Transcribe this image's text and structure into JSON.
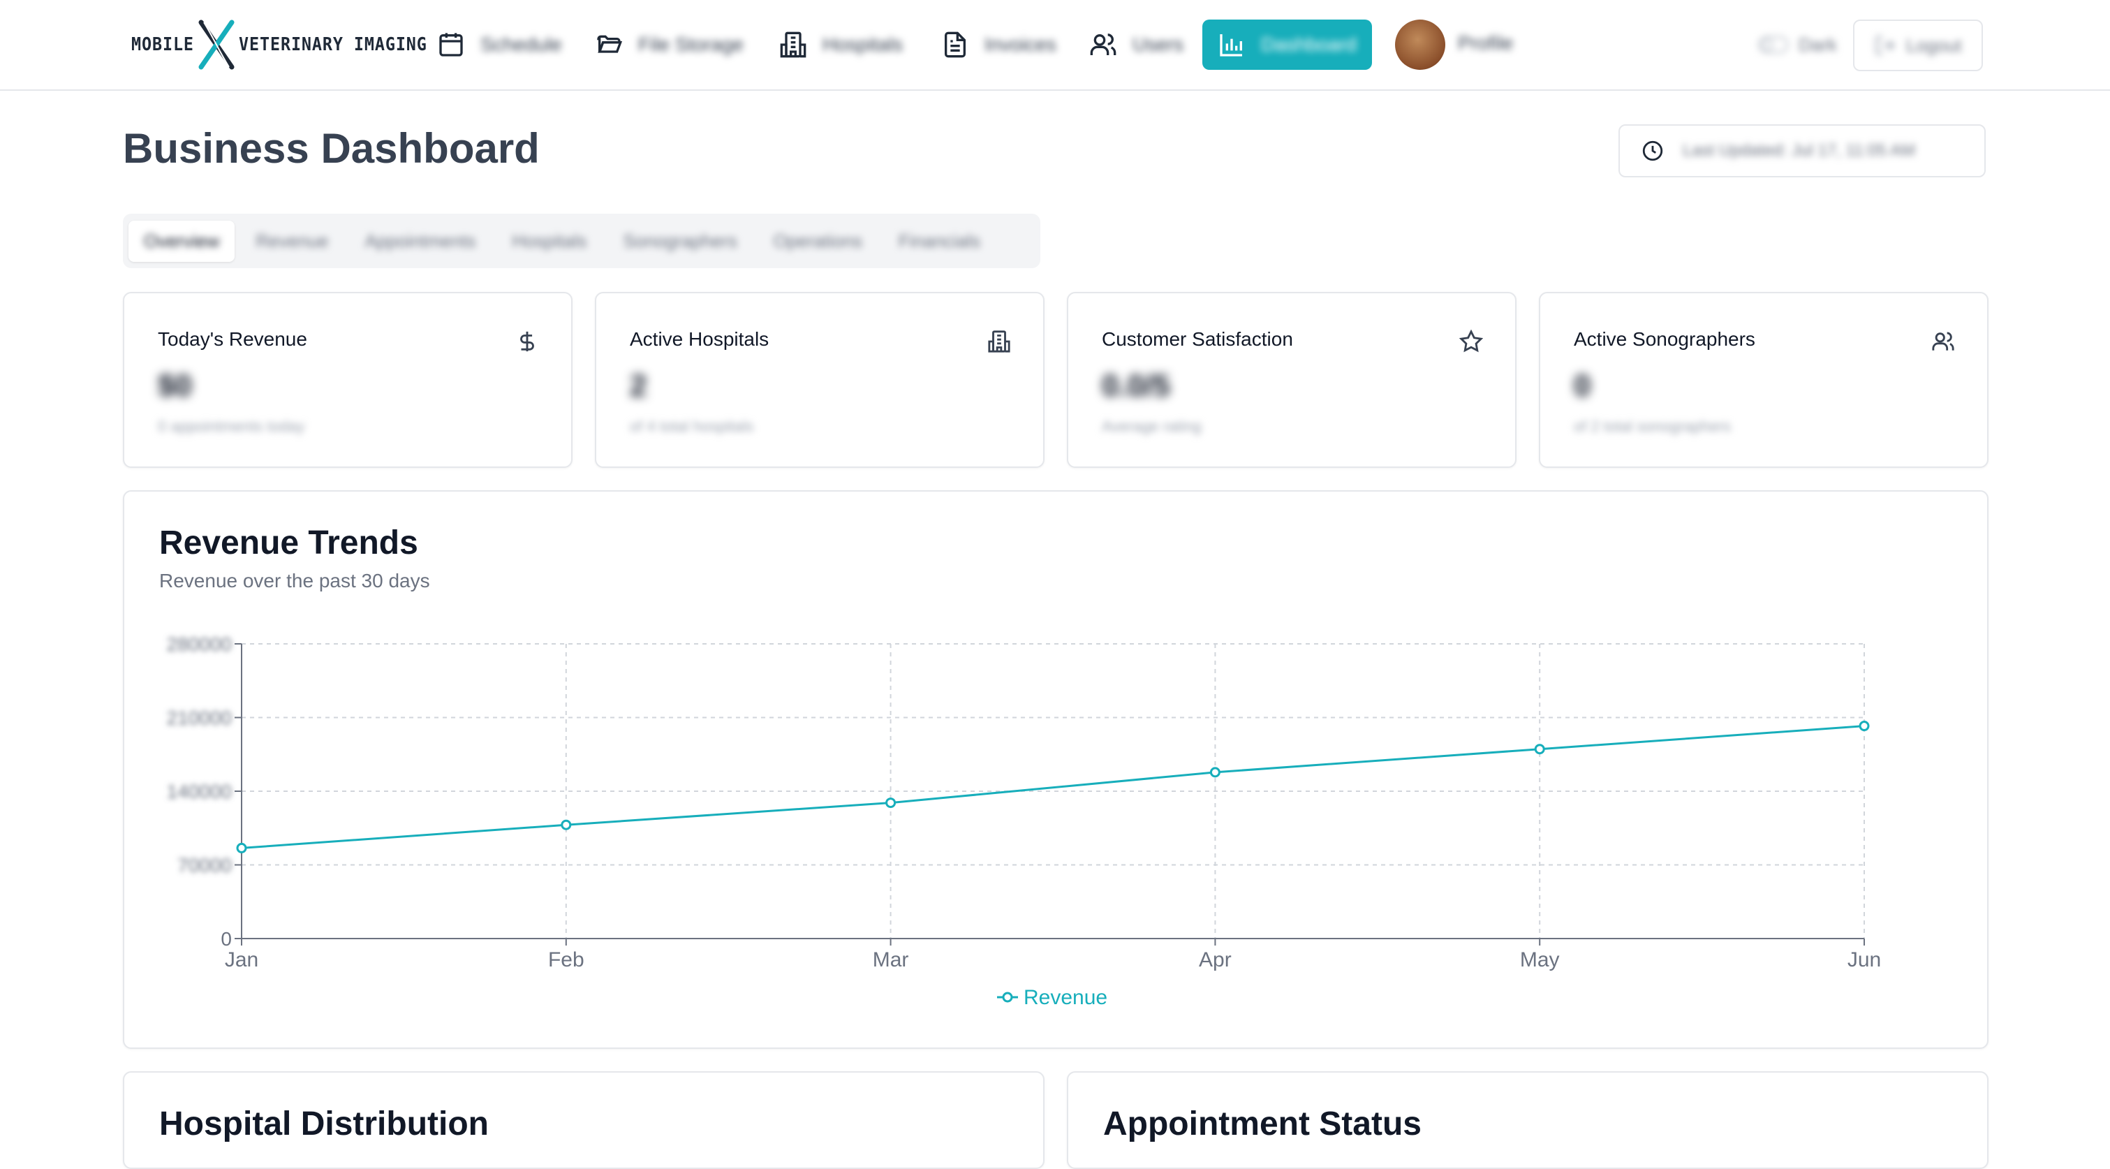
{
  "brand": {
    "left": "MOBILE",
    "right": "VETERINARY IMAGING"
  },
  "nav": {
    "items": [
      {
        "label": "Schedule",
        "icon": "calendar-icon"
      },
      {
        "label": "File Storage",
        "icon": "folder-icon"
      },
      {
        "label": "Hospitals",
        "icon": "building-icon"
      },
      {
        "label": "Invoices",
        "icon": "document-icon"
      },
      {
        "label": "Users",
        "icon": "users-icon"
      },
      {
        "label": "Dashboard",
        "icon": "bar-chart-icon",
        "active": true
      }
    ],
    "profile_label": "Profile",
    "theme_label": "Dark",
    "logout_label": "Logout",
    "accent": "#17aebb"
  },
  "page": {
    "title": "Business Dashboard",
    "last_updated": "Last Updated: Jul 17, 11:05 AM"
  },
  "tabs": [
    "Overview",
    "Revenue",
    "Appointments",
    "Hospitals",
    "Sonographers",
    "Operations",
    "Financials"
  ],
  "stats": [
    {
      "title": "Today's Revenue",
      "value": "$0",
      "sub": "0 appointments today",
      "icon": "dollar-icon"
    },
    {
      "title": "Active Hospitals",
      "value": "2",
      "sub": "of 4 total hospitals",
      "icon": "building-icon"
    },
    {
      "title": "Customer Satisfaction",
      "value": "0.0/5",
      "sub": "Average rating",
      "icon": "star-icon"
    },
    {
      "title": "Active Sonographers",
      "value": "0",
      "sub": "of 2 total sonographers",
      "icon": "users-icon"
    }
  ],
  "revenue_chart": {
    "title": "Revenue Trends",
    "subtitle": "Revenue over the past 30 days"
  },
  "chart_data": {
    "type": "line",
    "categories": [
      "Jan",
      "Feb",
      "Mar",
      "Apr",
      "May",
      "Jun"
    ],
    "series": [
      {
        "name": "Revenue",
        "values": [
          86000,
          108000,
          129000,
          158000,
          180000,
          202000
        ],
        "color": "#17aebb"
      }
    ],
    "ylim": [
      0,
      280000
    ],
    "yticks": [
      "0",
      "70000",
      "140000",
      "210000",
      "280000"
    ],
    "grid": true,
    "legend": "bottom"
  },
  "bottom": {
    "left_title": "Hospital Distribution",
    "right_title": "Appointment Status"
  }
}
